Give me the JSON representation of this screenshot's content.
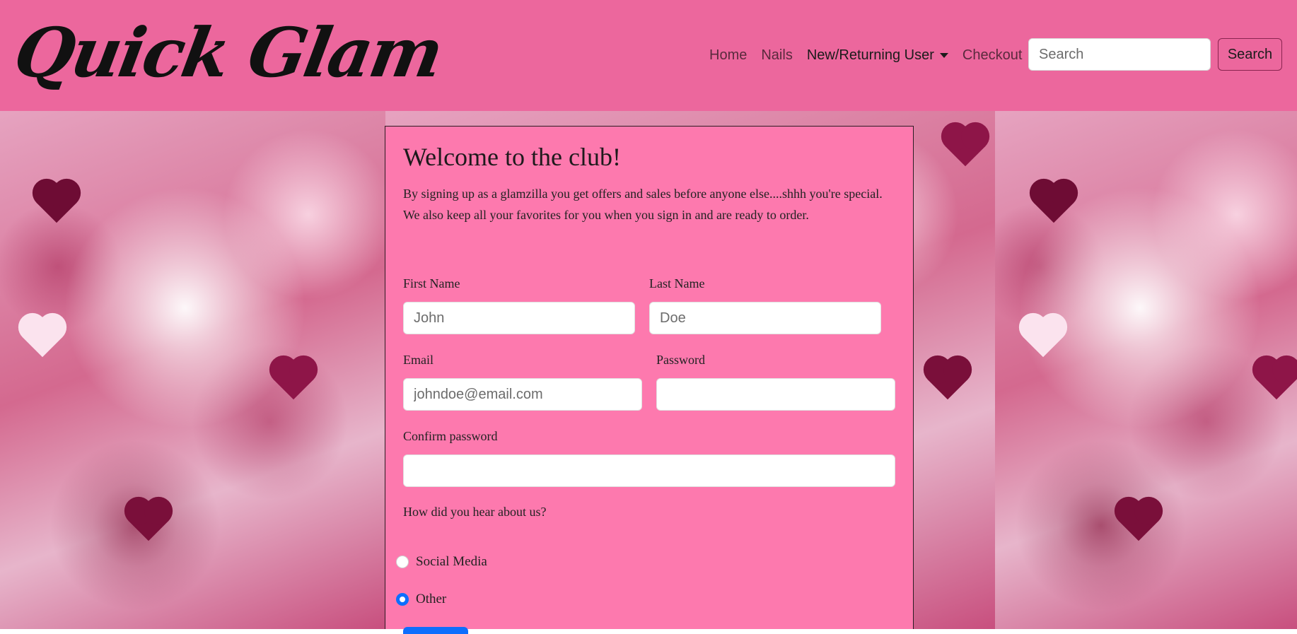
{
  "brand": {
    "logo_text": "Quick Glam"
  },
  "nav": {
    "links": [
      {
        "label": "Home"
      },
      {
        "label": "Nails"
      },
      {
        "label": "New/Returning User"
      },
      {
        "label": "Checkout"
      }
    ],
    "search_placeholder": "Search",
    "search_button": "Search"
  },
  "form": {
    "title": "Welcome to the club!",
    "intro": "By signing up as a glamzilla you get offers and sales before anyone else....shhh you're special. We also keep all your favorites for you when you sign in and are ready to order.",
    "first_name": {
      "label": "First Name",
      "placeholder": "John"
    },
    "last_name": {
      "label": "Last Name",
      "placeholder": "Doe"
    },
    "email": {
      "label": "Email",
      "placeholder": "johndoe@email.com"
    },
    "password": {
      "label": "Password",
      "placeholder": ""
    },
    "confirm_password": {
      "label": "Confirm password",
      "placeholder": ""
    },
    "referral": {
      "question": "How did you hear about us?",
      "options": [
        {
          "label": "Social Media",
          "checked": false
        },
        {
          "label": "Other",
          "checked": true
        }
      ]
    }
  },
  "colors": {
    "navbar_bg": "#ec679d",
    "card_bg": "#fd79ae",
    "radio_accent": "#0d6efd"
  }
}
